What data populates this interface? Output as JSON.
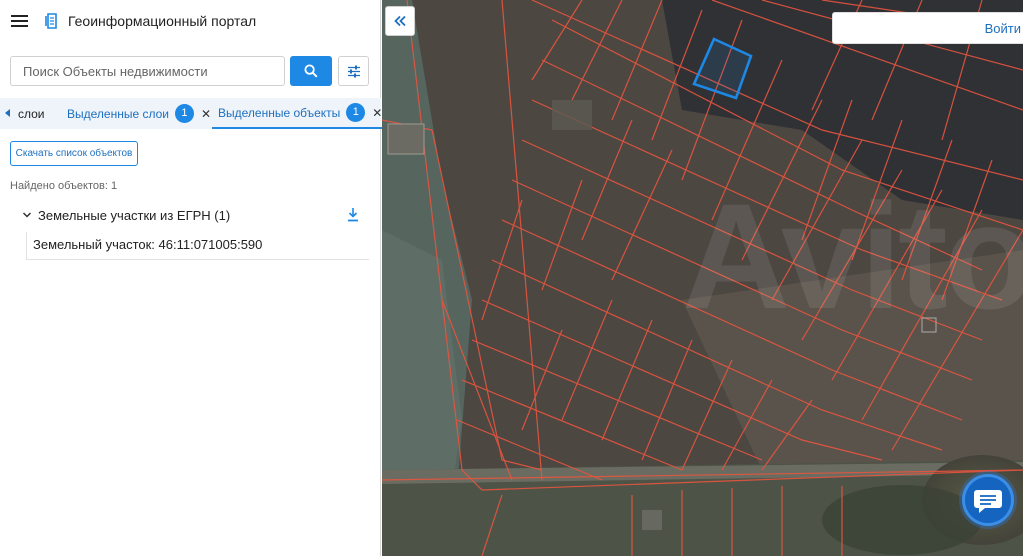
{
  "header": {
    "title": "Геоинформационный портал",
    "menu_icon": "hamburger-icon",
    "logo_icon": "portal-logo-icon"
  },
  "search": {
    "placeholder": "Поиск Объекты недвижимости",
    "value": "",
    "search_icon": "search-icon",
    "filter_icon": "filter-sliders-icon"
  },
  "tabs": [
    {
      "label": "слои"
    },
    {
      "label": "Выделенные слои",
      "count": "1"
    },
    {
      "label": "Выделенные объекты",
      "count": "1",
      "active": true
    }
  ],
  "results": {
    "download_label": "Скачать список объектов",
    "found_text": "Найдено объектов: 1",
    "group_label": "Земельные участки из ЕГРН (1)",
    "items": [
      {
        "label": "Земельный участок: 46:11:071005:590"
      }
    ]
  },
  "map": {
    "login_label": "Войти",
    "collapse_icon": "double-chevron-left-icon",
    "chat_icon": "chat-icon",
    "watermark": "Avito"
  },
  "colors": {
    "accent": "#1e88e5",
    "parcel_line": "#e8553f",
    "selected_parcel": "#1e88e5"
  }
}
